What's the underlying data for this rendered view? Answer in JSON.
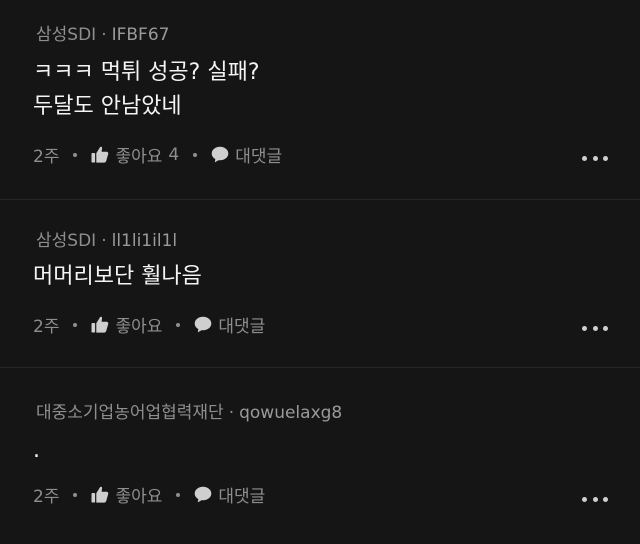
{
  "comments": [
    {
      "company": "삼성SDI",
      "username": "IFBF67",
      "lines": [
        "ㅋㅋㅋ 먹튀 성공? 실패?",
        "두달도 안남았네"
      ],
      "time": "2주",
      "like_label": "좋아요",
      "like_count": "4",
      "reply_label": "대댓글"
    },
    {
      "company": "삼성SDI",
      "username": "ll1li1il1l",
      "lines": [
        "머머리보단 훨나음"
      ],
      "time": "2주",
      "like_label": "좋아요",
      "like_count": "",
      "reply_label": "대댓글"
    },
    {
      "company": "대중소기업농어업협력재단",
      "username": "qowuelaxg8",
      "lines": [
        "."
      ],
      "time": "2주",
      "like_label": "좋아요",
      "like_count": "",
      "reply_label": "대댓글"
    }
  ],
  "separator": "·",
  "icons": {
    "like": "thumbs-up-icon",
    "reply": "speech-bubble-icon",
    "more": "more-dots-icon"
  },
  "colors": {
    "background": "#151515",
    "text": "#f4f4f4",
    "meta": "#8e8e8e"
  }
}
